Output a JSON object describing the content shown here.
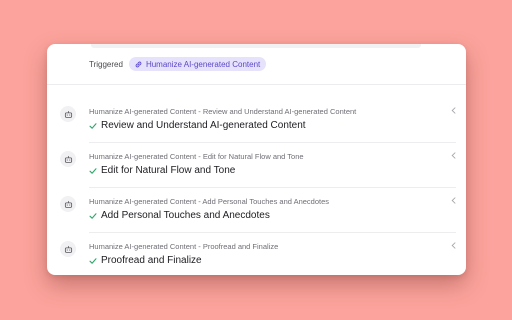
{
  "trigger": {
    "label": "Triggered",
    "chip_text": "Humanize AI-generated Content",
    "chip_icon": "link-icon"
  },
  "steps": [
    {
      "subtitle": "Humanize AI-generated Content - Review and Understand AI-generated Content",
      "title": "Review and Understand AI-generated Content",
      "status": "complete"
    },
    {
      "subtitle": "Humanize AI-generated Content - Edit for Natural Flow and Tone",
      "title": "Edit for Natural Flow and Tone",
      "status": "complete"
    },
    {
      "subtitle": "Humanize AI-generated Content - Add Personal Touches and Anecdotes",
      "title": "Add Personal Touches and Anecdotes",
      "status": "complete"
    },
    {
      "subtitle": "Humanize AI-generated Content - Proofread and Finalize",
      "title": "Proofread and Finalize",
      "status": "complete"
    }
  ],
  "colors": {
    "background": "#fba39c",
    "card": "#ffffff",
    "chip_bg": "#e7e2fb",
    "chip_text": "#5a48c8",
    "check": "#2fa66a"
  }
}
